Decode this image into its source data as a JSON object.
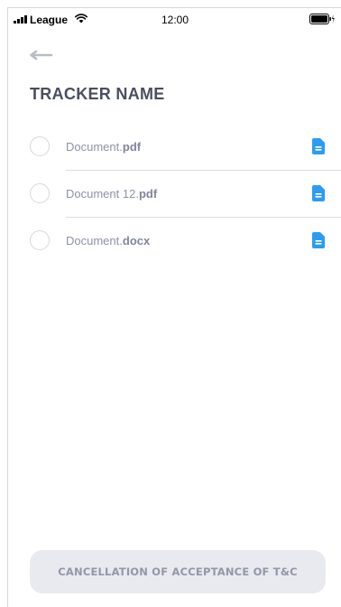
{
  "status_bar": {
    "carrier": "League",
    "time": "12:00"
  },
  "header": {
    "title": "TRACKER NAME"
  },
  "documents": [
    {
      "name": "Document.",
      "ext": "pdf",
      "selected": false,
      "icon": "document-icon"
    },
    {
      "name": "Document 12.",
      "ext": "pdf",
      "selected": false,
      "icon": "document-icon"
    },
    {
      "name": "Document.",
      "ext": "docx",
      "selected": false,
      "icon": "document-icon"
    }
  ],
  "footer": {
    "button_label": "CANCELLATION OF ACCEPTANCE OF T&C"
  },
  "colors": {
    "accent": "#2b9cf2",
    "title": "#4a4f5e",
    "text_muted": "#8d93a6",
    "button_bg": "#e9eaf0"
  }
}
